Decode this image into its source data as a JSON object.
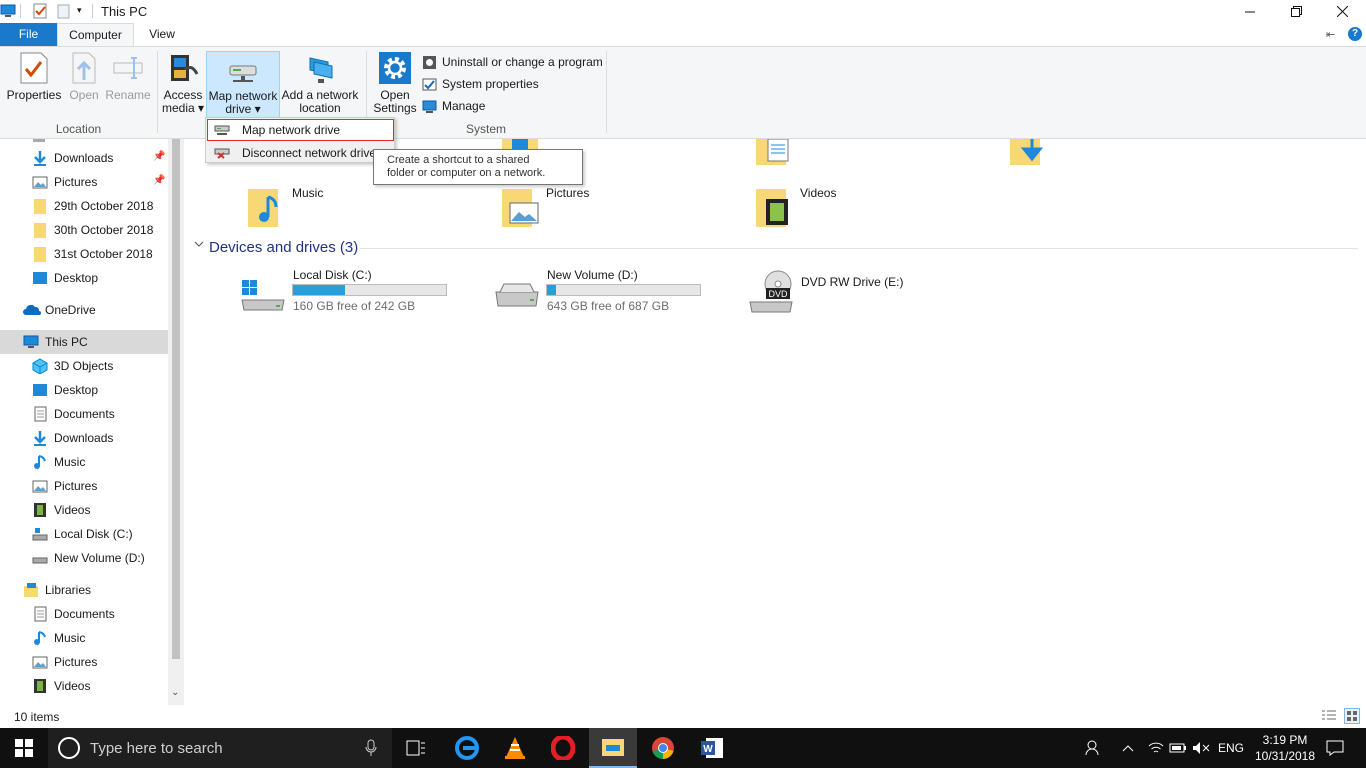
{
  "window": {
    "title": "This PC"
  },
  "tabs": {
    "file": "File",
    "computer": "Computer",
    "view": "View"
  },
  "ribbon": {
    "properties": "Properties",
    "open": "Open",
    "rename": "Rename",
    "location_group": "Location",
    "access_media_1": "Access",
    "access_media_2": "media ▾",
    "map_drive_1": "Map network",
    "map_drive_2": "drive ▾",
    "add_location_1": "Add a network",
    "add_location_2": "location",
    "open_settings_1": "Open",
    "open_settings_2": "Settings",
    "uninstall": "Uninstall or change a program",
    "system_properties": "System properties",
    "manage": "Manage",
    "system_group": "System"
  },
  "dropdown": {
    "map": "Map network drive",
    "disconnect": "Disconnect network drive"
  },
  "tooltip": {
    "line1": "Create a shortcut to a shared",
    "line2": "folder or computer on a network."
  },
  "nav": {
    "quick": [
      {
        "label": "Downloads"
      },
      {
        "label": "Pictures"
      },
      {
        "label": "29th October 2018"
      },
      {
        "label": "30th October 2018"
      },
      {
        "label": "31st October 2018"
      },
      {
        "label": "Desktop"
      }
    ],
    "onedrive": "OneDrive",
    "thispc": "This PC",
    "pc_items": [
      {
        "label": "3D Objects"
      },
      {
        "label": "Desktop"
      },
      {
        "label": "Documents"
      },
      {
        "label": "Downloads"
      },
      {
        "label": "Music"
      },
      {
        "label": "Pictures"
      },
      {
        "label": "Videos"
      },
      {
        "label": "Local Disk (C:)"
      },
      {
        "label": "New Volume (D:)"
      }
    ],
    "libraries": "Libraries",
    "lib_items": [
      {
        "label": "Documents"
      },
      {
        "label": "Music"
      },
      {
        "label": "Pictures"
      },
      {
        "label": "Videos"
      }
    ]
  },
  "content": {
    "folders": [
      {
        "label": "Music"
      },
      {
        "label": "Pictures"
      },
      {
        "label": "Videos"
      }
    ],
    "devices_header": "Devices and drives (3)",
    "drives": [
      {
        "name": "Local Disk (C:)",
        "free": "160 GB free of 242 GB",
        "used_fraction": 0.34
      },
      {
        "name": "New Volume (D:)",
        "free": "643 GB free of 687 GB",
        "used_fraction": 0.06
      },
      {
        "name": "DVD RW Drive (E:)"
      }
    ],
    "dvd_label": "DVD"
  },
  "status": {
    "items": "10 items"
  },
  "taskbar": {
    "search_placeholder": "Type here to search",
    "lang": "ENG",
    "time": "3:19 PM",
    "date": "10/31/2018"
  },
  "colors": {
    "accent": "#1979ca",
    "selection": "#cce8ff",
    "drive_bar": "#26a0da"
  }
}
